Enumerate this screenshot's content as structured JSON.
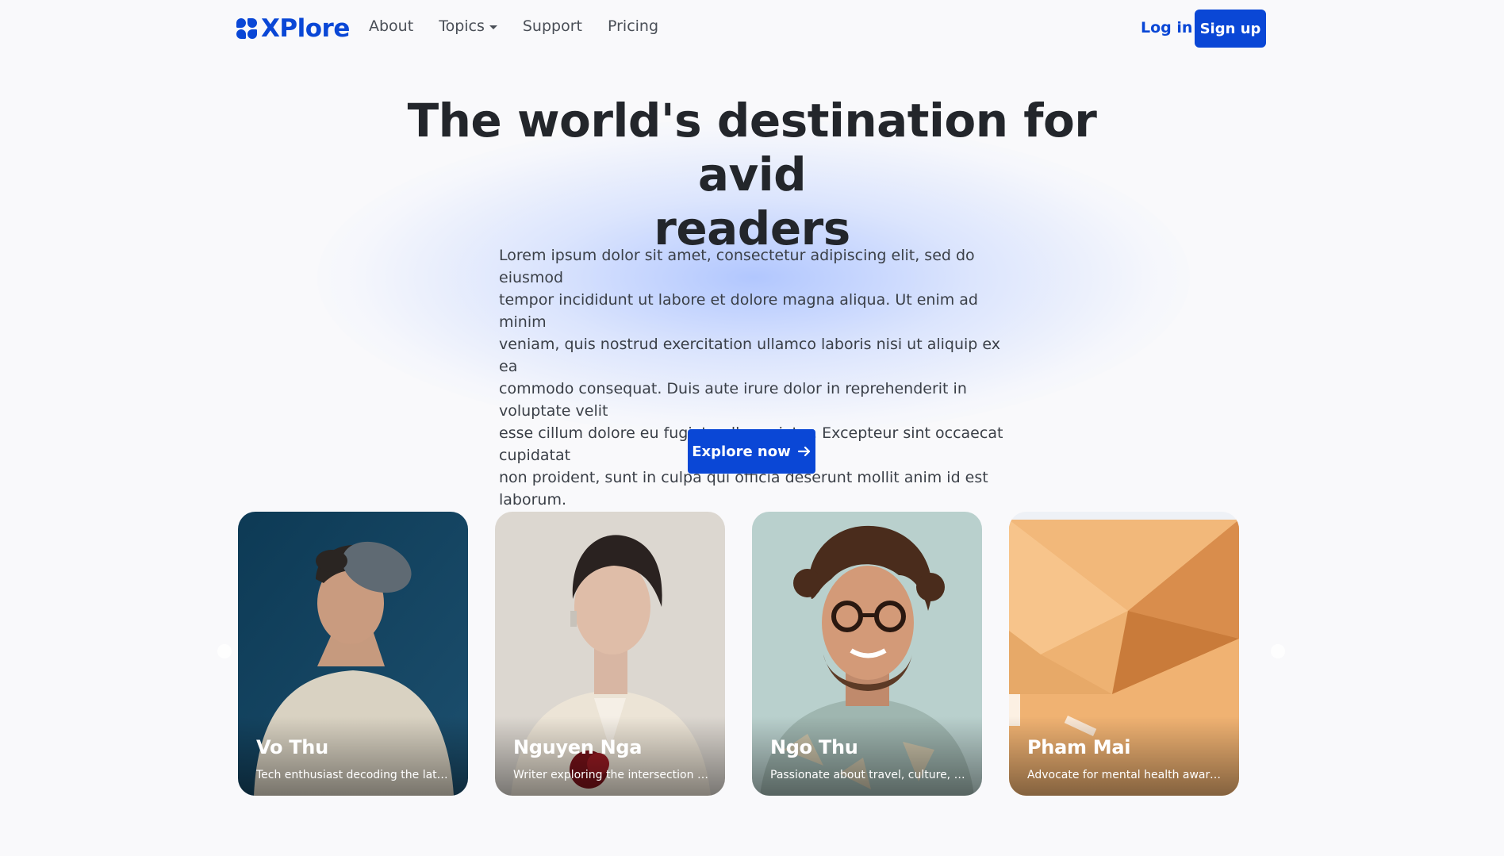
{
  "nav": {
    "brand": "XPlore",
    "links": [
      {
        "label": "About"
      },
      {
        "label": "Topics"
      },
      {
        "label": "Support"
      },
      {
        "label": "Pricing"
      }
    ],
    "login": "Log in",
    "signup": "Sign up"
  },
  "hero": {
    "headline_line1": "The world's destination for avid",
    "headline_line2": "readers",
    "lead_lines": [
      "Lorem ipsum dolor sit amet, consectetur adipiscing elit, sed do eiusmod",
      "tempor incididunt ut labore et dolore magna aliqua. Ut enim ad minim",
      "veniam, quis nostrud exercitation ullamco laboris nisi ut aliquip ex ea",
      "commodo consequat. Duis aute irure dolor in reprehenderit in voluptate velit",
      "esse cillum dolore eu fugiat nulla pariatur. Excepteur sint occaecat cupidatat",
      "non proident, sunt in culpa qui officia deserunt mollit anim id est laborum."
    ],
    "cta": "Explore now"
  },
  "authors": [
    {
      "name": "Vo Thu",
      "desc": "Tech enthusiast decoding the latest trends"
    },
    {
      "name": "Nguyen Nga",
      "desc": "Writer exploring the intersection of technology"
    },
    {
      "name": "Ngo Thu",
      "desc": "Passionate about travel, culture, and stories"
    },
    {
      "name": "Pham Mai",
      "desc": "Advocate for mental health awareness"
    }
  ],
  "colors": {
    "brand": "#0a47d6",
    "background": "#f9f9fb"
  }
}
